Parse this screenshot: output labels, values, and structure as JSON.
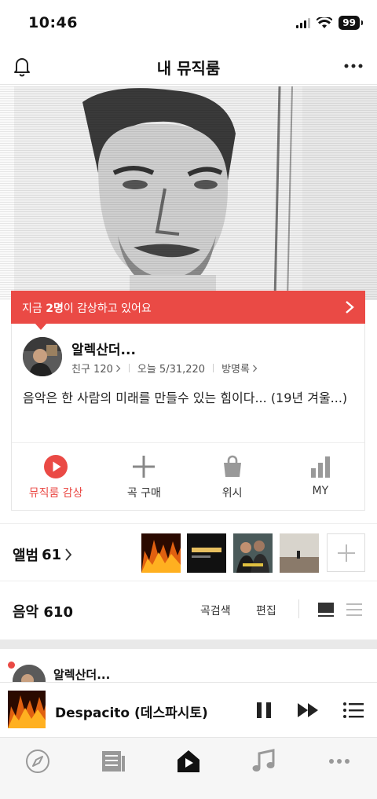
{
  "status_bar": {
    "time": "10:46",
    "battery": "99",
    "signal_icon": "cellular-signal-icon",
    "wifi_icon": "wifi-icon"
  },
  "header": {
    "title": "내 뮤직룸",
    "left_icon": "bell-icon",
    "right_icon": "more-icon"
  },
  "listening": {
    "prefix": "지금 ",
    "count": "2명",
    "suffix": "이 감상하고 있어요"
  },
  "profile": {
    "name": "알렉산더...",
    "friends": "친구 120",
    "visits": "오늘 5/31,220",
    "guestbook": "방명록",
    "bio": "음악은 한 사람의 미래를 만들수 있는 힘이다... (19년 겨울...)"
  },
  "actions": [
    {
      "label": "뮤직룸 감상",
      "icon": "play-circle-icon"
    },
    {
      "label": "곡 구매",
      "icon": "plus-icon"
    },
    {
      "label": "위시",
      "icon": "shopping-bag-icon"
    },
    {
      "label": "MY",
      "icon": "bar-chart-icon"
    }
  ],
  "albums": {
    "label": "앨범",
    "count": "61"
  },
  "music": {
    "label": "음악",
    "count": "610",
    "search_label": "곡검색",
    "edit_label": "편집"
  },
  "feed": {
    "name": "알렉산더..."
  },
  "player": {
    "title": "Despacito (데스파시토)"
  },
  "tabs": [
    "compass-icon",
    "feed-icon",
    "music-room-icon",
    "music-note-icon",
    "more-icon"
  ],
  "colors": {
    "accent": "#ea4a45"
  }
}
